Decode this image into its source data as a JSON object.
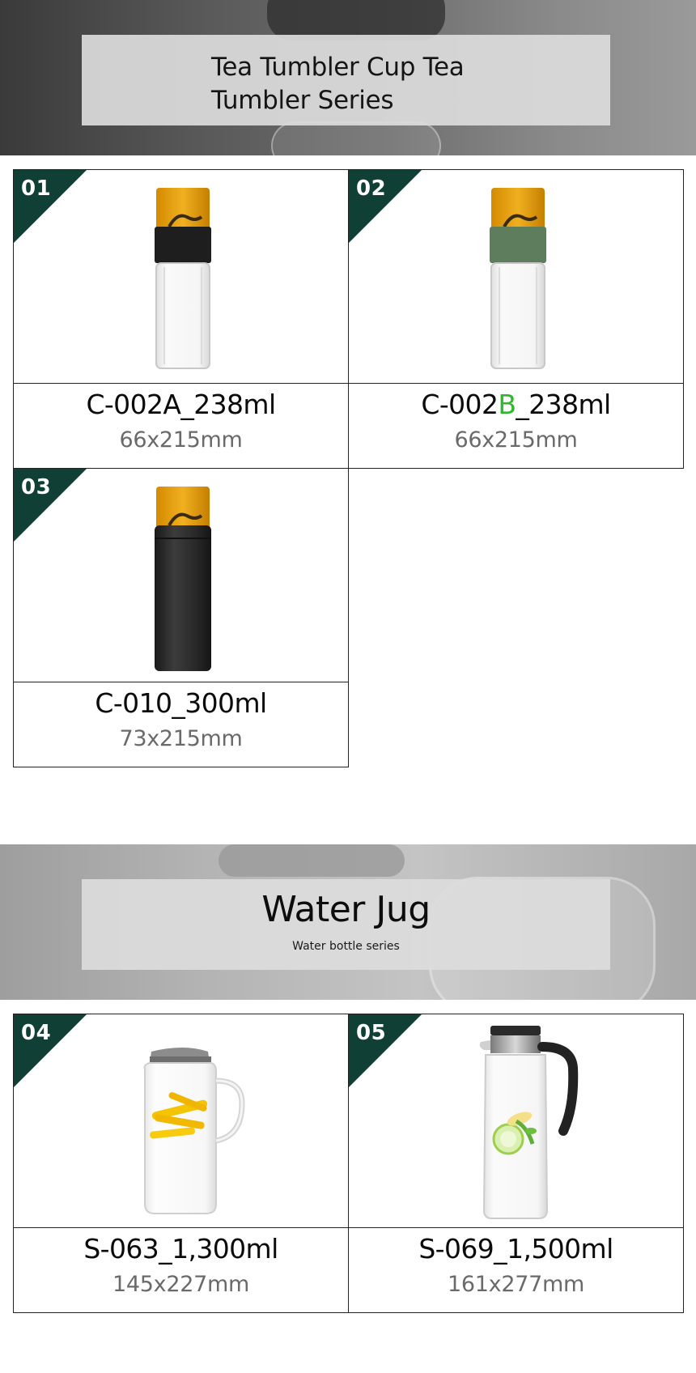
{
  "tumbler_banner": {
    "title": "Tea Tumbler Cup Tea Tumbler Series"
  },
  "tumbler_products": [
    {
      "number": "01",
      "name_main": "C-002A_238ml",
      "name_pre": "",
      "name_hl": "",
      "name_post": "",
      "dimensions": "66x215mm",
      "image": "tea-tumbler-black-band"
    },
    {
      "number": "02",
      "name_main": "",
      "name_pre": "C-002",
      "name_hl": "B",
      "name_post": "_238ml",
      "dimensions": "66x215mm",
      "image": "tea-tumbler-green-band"
    },
    {
      "number": "03",
      "name_main": "C-010_300ml",
      "name_pre": "",
      "name_hl": "",
      "name_post": "",
      "dimensions": "73x215mm",
      "image": "tea-tumbler-black-body"
    }
  ],
  "jug_banner": {
    "title": "Water Jug",
    "subtitle": "Water bottle series"
  },
  "jug_products": [
    {
      "number": "04",
      "name_main": "S-063_1,300ml",
      "dimensions": "145x227mm",
      "image": "water-jug-lemon"
    },
    {
      "number": "05",
      "name_main": "S-069_1,500ml",
      "dimensions": "161x277mm",
      "image": "water-jug-cucumber-black-handle"
    }
  ],
  "colors": {
    "badge": "#0f3f35",
    "highlight": "#2eb82e",
    "dimension_text": "#6a6a6a"
  }
}
